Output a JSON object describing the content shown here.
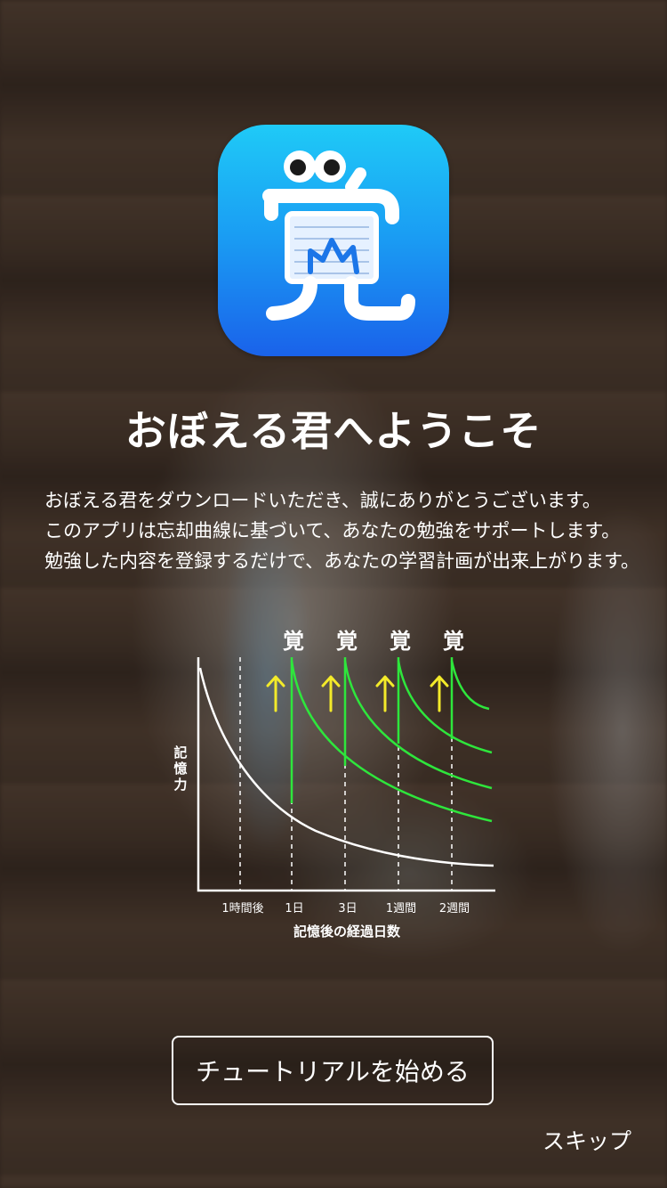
{
  "welcome": {
    "title": "おぼえる君へようこそ",
    "app_icon_char": "覚",
    "description": [
      "おぼえる君をダウンロードいただき、誠にありがとうございます。",
      "このアプリは忘却曲線に基づいて、あなたの勉強をサポートします。",
      "勉強した内容を登録するだけで、あなたの学習計画が出来上がります。"
    ]
  },
  "graph": {
    "y_label": "記憶力",
    "x_label": "記憶後の経過日数",
    "ticks": [
      "1時間後",
      "1日",
      "3日",
      "1週間",
      "2週間"
    ],
    "review_mark_char": "覚",
    "colors": {
      "curve": "#ffffff",
      "review": "#2ee63c",
      "arrow": "#f3ea2a"
    }
  },
  "actions": {
    "tutorial_label": "チュートリアルを始める",
    "skip_label": "スキップ"
  }
}
